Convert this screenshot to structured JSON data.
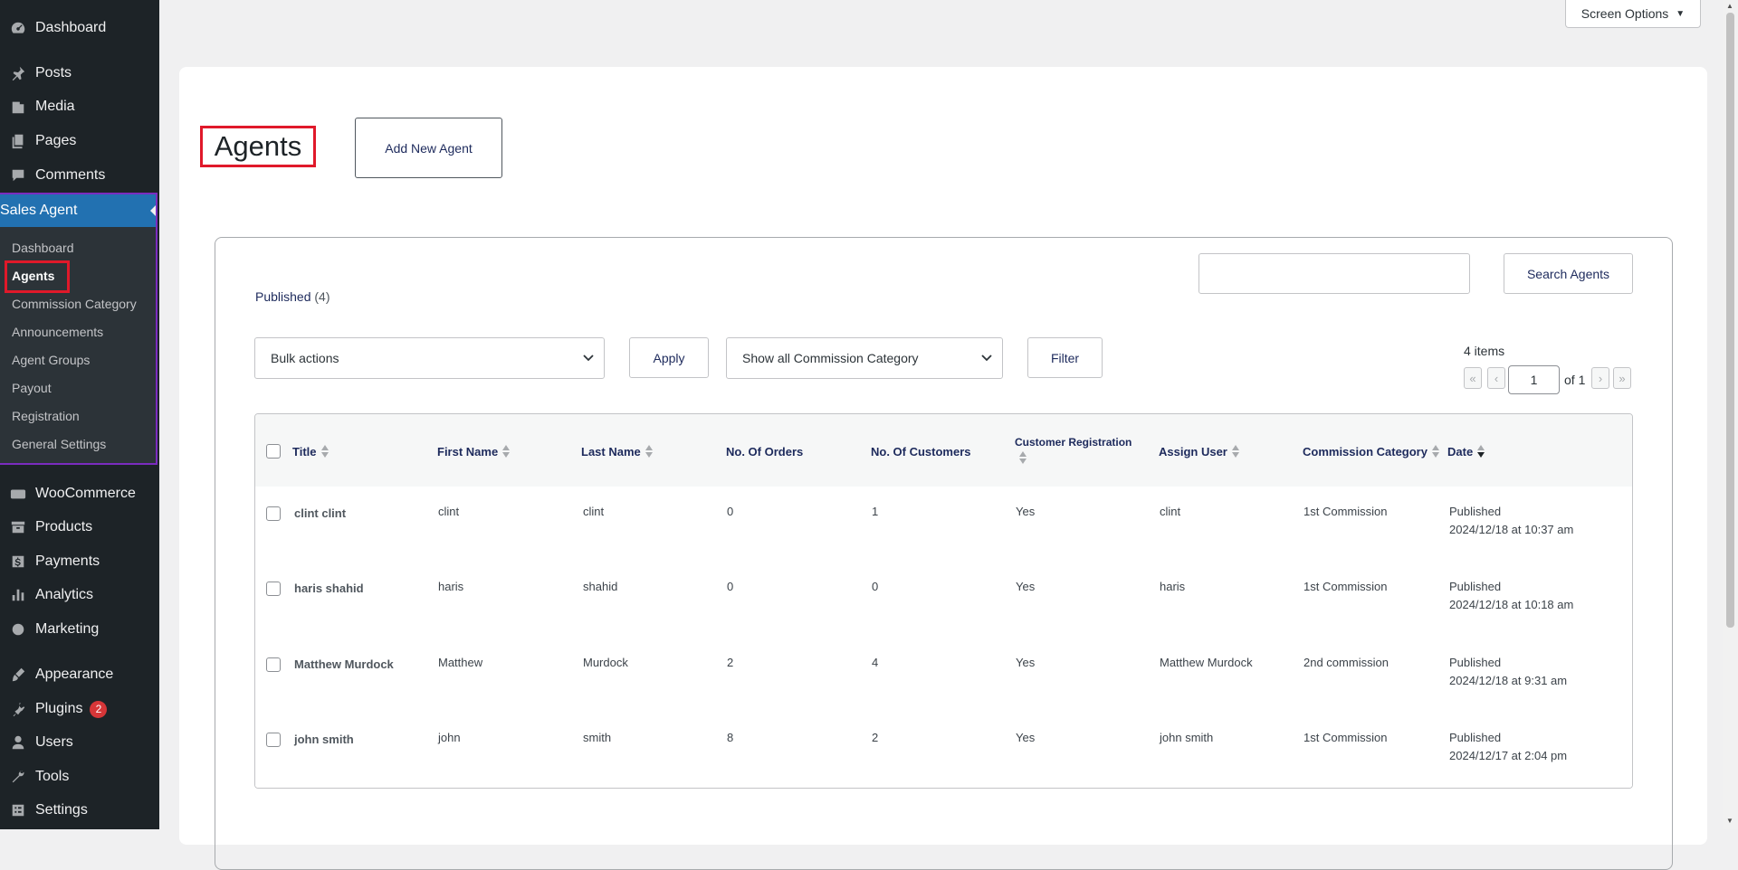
{
  "sidebar": {
    "items_top": [
      {
        "label": "Dashboard",
        "icon": "dashboard-icon"
      },
      {
        "label": "Posts",
        "icon": "pin-icon"
      },
      {
        "label": "Media",
        "icon": "media-icon"
      },
      {
        "label": "Pages",
        "icon": "pages-icon"
      },
      {
        "label": "Comments",
        "icon": "comment-icon"
      }
    ],
    "sales_agent": {
      "label": "Sales Agent",
      "icon": "user-icon",
      "submenu": [
        "Dashboard",
        "Agents",
        "Commission Category",
        "Announcements",
        "Agent Groups",
        "Payout",
        "Registration",
        "General Settings"
      ]
    },
    "items_bottom": [
      {
        "label": "WooCommerce",
        "icon": "woo-icon"
      },
      {
        "label": "Products",
        "icon": "archive-icon"
      },
      {
        "label": "Payments",
        "icon": "dollar-icon"
      },
      {
        "label": "Analytics",
        "icon": "chart-icon"
      },
      {
        "label": "Marketing",
        "icon": "megaphone-icon"
      },
      {
        "label": "Appearance",
        "icon": "brush-icon"
      },
      {
        "label": "Plugins",
        "icon": "plugin-icon",
        "badge": "2"
      },
      {
        "label": "Users",
        "icon": "users-icon"
      },
      {
        "label": "Tools",
        "icon": "wrench-icon"
      },
      {
        "label": "Settings",
        "icon": "settings-icon"
      }
    ]
  },
  "screen_options": "Screen Options",
  "page": {
    "title": "Agents",
    "add_new": "Add New Agent",
    "published_label": "Published",
    "published_count": "(4)",
    "search_button": "Search Agents",
    "bulk_actions": "Bulk actions",
    "apply": "Apply",
    "category_filter": "Show all Commission Category",
    "filter": "Filter",
    "items_count": "4 items",
    "current_page": "1",
    "page_of": "of 1",
    "pager": {
      "first": "«",
      "prev": "‹",
      "next": "›",
      "last": "»"
    }
  },
  "table": {
    "columns": [
      "Title",
      "First Name",
      "Last Name",
      "No. Of Orders",
      "No. Of Customers",
      "Customer Registration",
      "Assign User",
      "Commission Category",
      "Date"
    ],
    "rows": [
      {
        "title": "clint clint",
        "first": "clint",
        "last": "clint",
        "orders": "0",
        "customers": "1",
        "registration": "Yes",
        "user": "clint",
        "category": "1st Commission",
        "status": "Published",
        "date": "2024/12/18 at 10:37 am"
      },
      {
        "title": "haris shahid",
        "first": "haris",
        "last": "shahid",
        "orders": "0",
        "customers": "0",
        "registration": "Yes",
        "user": "haris",
        "category": "1st Commission",
        "status": "Published",
        "date": "2024/12/18 at 10:18 am"
      },
      {
        "title": "Matthew Murdock",
        "first": "Matthew",
        "last": "Murdock",
        "orders": "2",
        "customers": "4",
        "registration": "Yes",
        "user": "Matthew Murdock",
        "category": "2nd commission",
        "status": "Published",
        "date": "2024/12/18 at 9:31 am"
      },
      {
        "title": "john smith",
        "first": "john",
        "last": "smith",
        "orders": "8",
        "customers": "2",
        "registration": "Yes",
        "user": "john smith",
        "category": "1st Commission",
        "status": "Published",
        "date": "2024/12/17 at 2:04 pm"
      }
    ]
  }
}
